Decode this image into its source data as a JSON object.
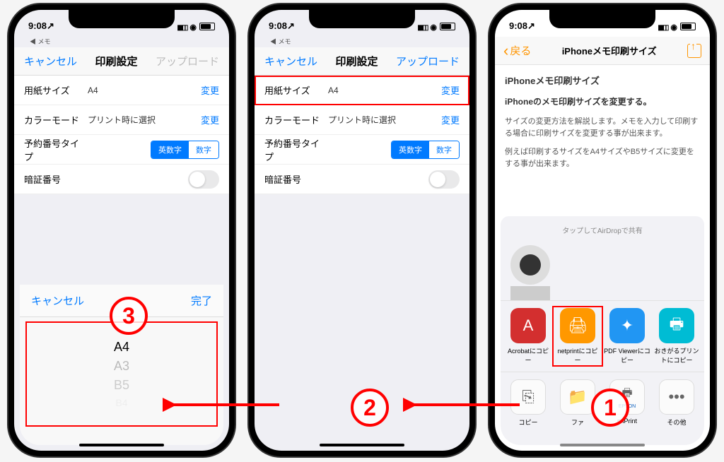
{
  "status": {
    "time": "9:08",
    "loc_icon": "↗",
    "sub": "◀ メモ"
  },
  "phone1": {
    "nav": {
      "cancel": "キャンセル",
      "title": "印刷設定",
      "upload": "アップロード"
    },
    "rows": {
      "paper": {
        "label": "用紙サイズ",
        "value": "A4",
        "action": "変更"
      },
      "color": {
        "label": "カラーモード",
        "value": "プリント時に選択",
        "action": "変更"
      },
      "numtype": {
        "label": "予約番号タイプ",
        "seg1": "英数字",
        "seg2": "数字"
      },
      "pin": {
        "label": "暗証番号"
      }
    },
    "picker": {
      "cancel": "キャンセル",
      "done": "完了",
      "items": [
        "A4",
        "A3",
        "B5",
        "B4"
      ]
    },
    "circle": "3"
  },
  "phone2": {
    "nav": {
      "cancel": "キャンセル",
      "title": "印刷設定",
      "upload": "アップロード"
    },
    "rows": {
      "paper": {
        "label": "用紙サイズ",
        "value": "A4",
        "action": "変更"
      },
      "color": {
        "label": "カラーモード",
        "value": "プリント時に選択",
        "action": "変更"
      },
      "numtype": {
        "label": "予約番号タイプ",
        "seg1": "英数字",
        "seg2": "数字"
      },
      "pin": {
        "label": "暗証番号"
      }
    },
    "circle": "2"
  },
  "phone3": {
    "nav": {
      "back": "戻る",
      "title": "iPhoneメモ印刷サイズ"
    },
    "note": {
      "title": "iPhoneメモ印刷サイズ",
      "sub": "iPhoneのメモ印刷サイズを変更する。",
      "p1": "サイズの変更方法を解説します。メモを入力して印刷する場合に印刷サイズを変更する事が出来ます。",
      "p2": "例えば印刷するサイズをA4サイズやB5サイズに変更をする事が出来ます。"
    },
    "sheet": {
      "airdrop": "タップしてAirDropで共有",
      "apps": [
        {
          "label": "Acrobatにコピー"
        },
        {
          "label": "netprintにコピー"
        },
        {
          "label": "PDF Viewerにコピー"
        },
        {
          "label": "おきがるプリントにコピー"
        }
      ],
      "actions": [
        {
          "glyph": "⎘",
          "label": "コピー"
        },
        {
          "glyph": "📁",
          "label": "ファ"
        },
        {
          "glyph": "🖶",
          "sub": "EPSON",
          "label": "n iPrint"
        },
        {
          "glyph": "•••",
          "label": "その他"
        }
      ]
    },
    "circle": "1"
  }
}
